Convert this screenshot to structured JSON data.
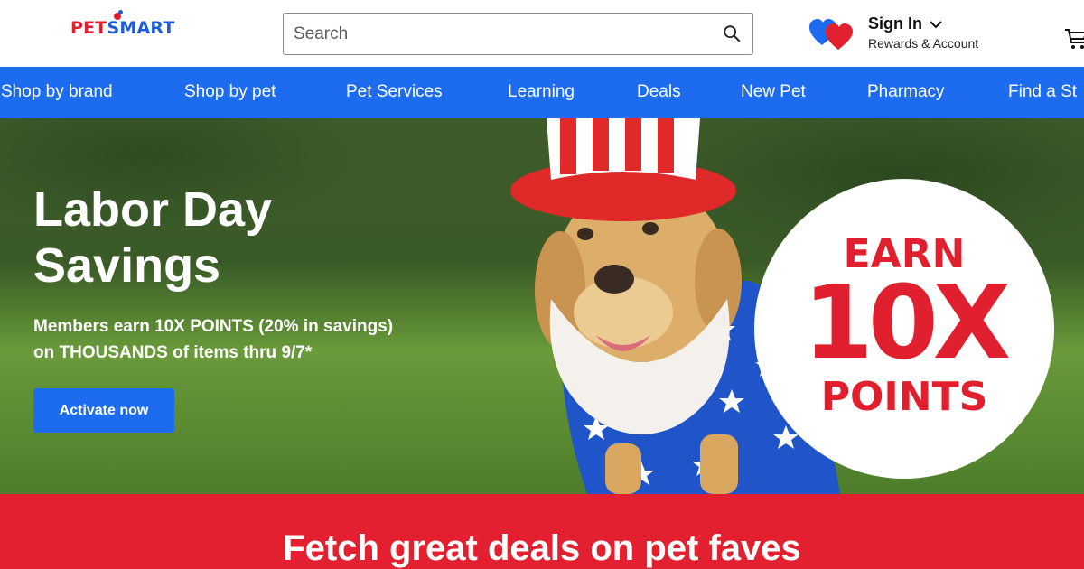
{
  "header": {
    "logo": {
      "part1": "PET",
      "part2": "SMART"
    },
    "search": {
      "placeholder": "Search"
    },
    "account": {
      "title": "Sign In",
      "subtitle": "Rewards & Account"
    }
  },
  "nav": {
    "items": [
      "Shop by brand",
      "Shop by pet",
      "Pet Services",
      "Learning",
      "Deals",
      "New Pet",
      "Pharmacy",
      "Find a St"
    ]
  },
  "hero": {
    "title_line1": "Labor Day",
    "title_line2": "Savings",
    "subtitle_line1": "Members earn 10X POINTS (20% in savings)",
    "subtitle_line2": "on THOUSANDS of items thru 9/7*",
    "cta": "Activate now",
    "badge": {
      "line1": "EARN",
      "line2": "10X",
      "line3": "POINTS"
    }
  },
  "banner": {
    "text": "Fetch great deals on pet faves"
  },
  "colors": {
    "brand_blue": "#1d6cf0",
    "brand_red": "#e2202f"
  },
  "icons": [
    "search-icon",
    "hearts-icon",
    "chevron-down-icon",
    "cart-icon"
  ]
}
